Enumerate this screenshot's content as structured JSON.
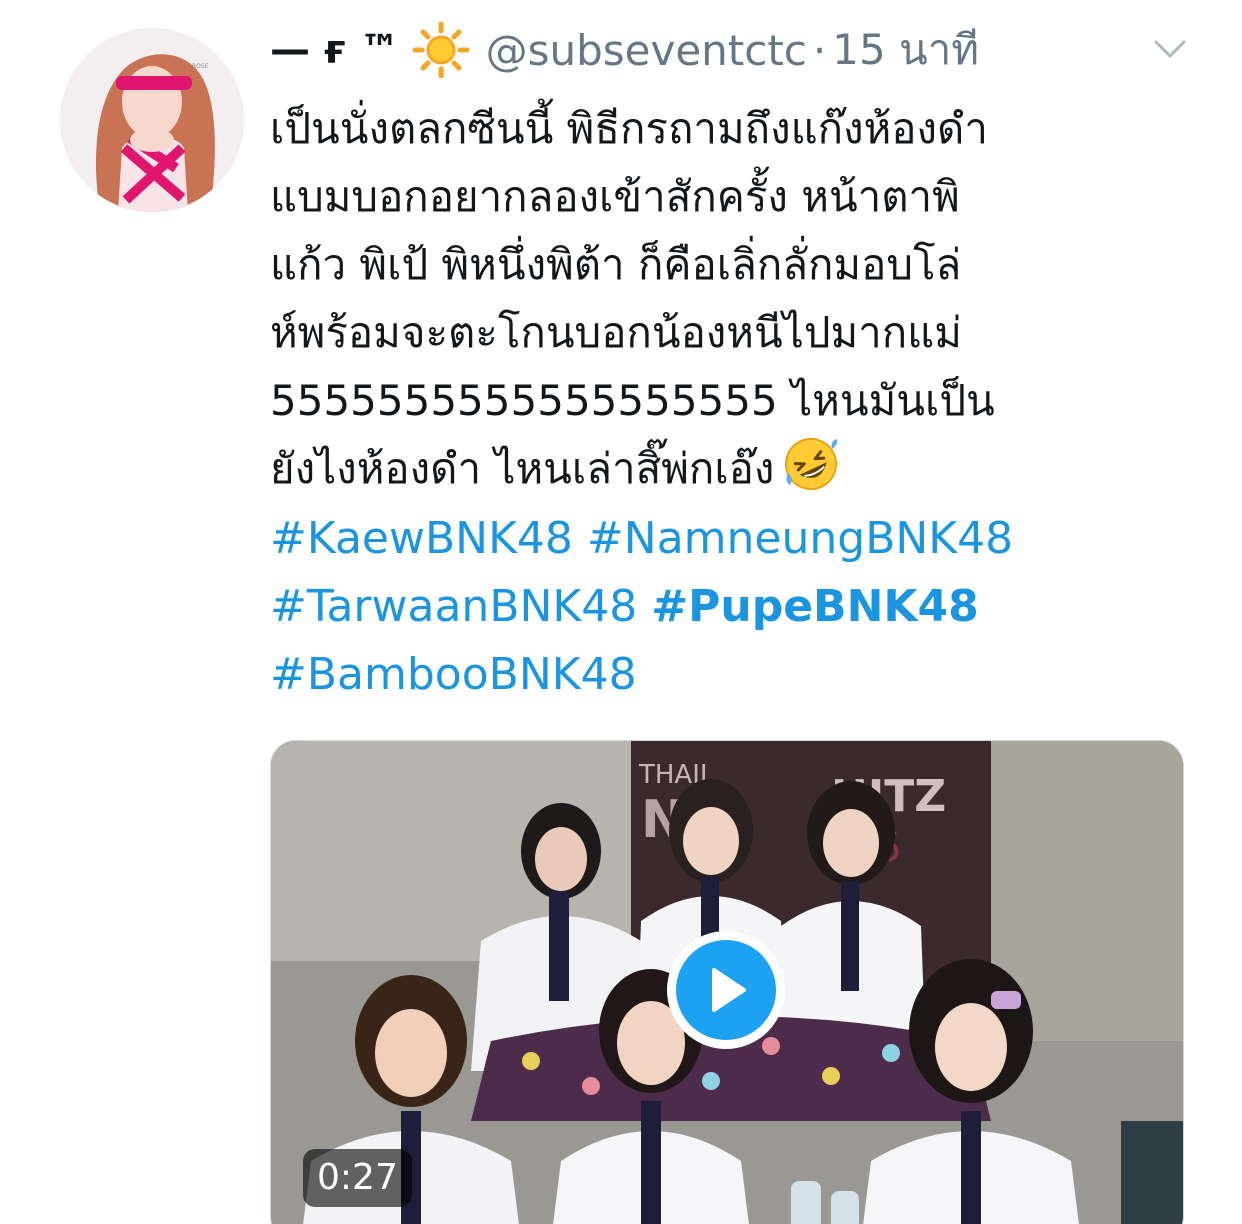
{
  "tweet": {
    "display_name": "— ғ ™",
    "name_emoji": "sun-icon",
    "handle": "@subseventctc",
    "separator": "·",
    "time": "15 นาที",
    "lines": [
      "เป็นนั่งตลกซีนนี้ พิธีกรถามถึงแก๊งห้องดำ",
      "แบมบอกอยากลองเข้าสักครั้ง หน้าตาพิ",
      "แก้ว พิเป้ พิหนึ่งพิต้า ก็คือเลิ่กลั่กมอบโล่",
      "ห์พร้อมจะตะโกนบอกน้องหนีไปมากแม่",
      "5555555555555555555 ไหนมันเป็น",
      "ยังไงห้องดำ ไหนเล่าสิ๊พ่กเอ๊ง"
    ],
    "end_emoji": "rofl-emoji",
    "hashtags": [
      "#KaewBNK48",
      "#NamneungBNK48",
      "#TarwaanBNK48",
      "#PupeBNK48",
      "#BambooBNK48"
    ],
    "video": {
      "duration": "0:27",
      "background_text": [
        "THAIL",
        "NO",
        "HITZ",
        "55"
      ]
    }
  },
  "colors": {
    "text": "#14171a",
    "muted": "#657786",
    "link": "#1b95e0",
    "play_accent": "#1da1f2"
  }
}
